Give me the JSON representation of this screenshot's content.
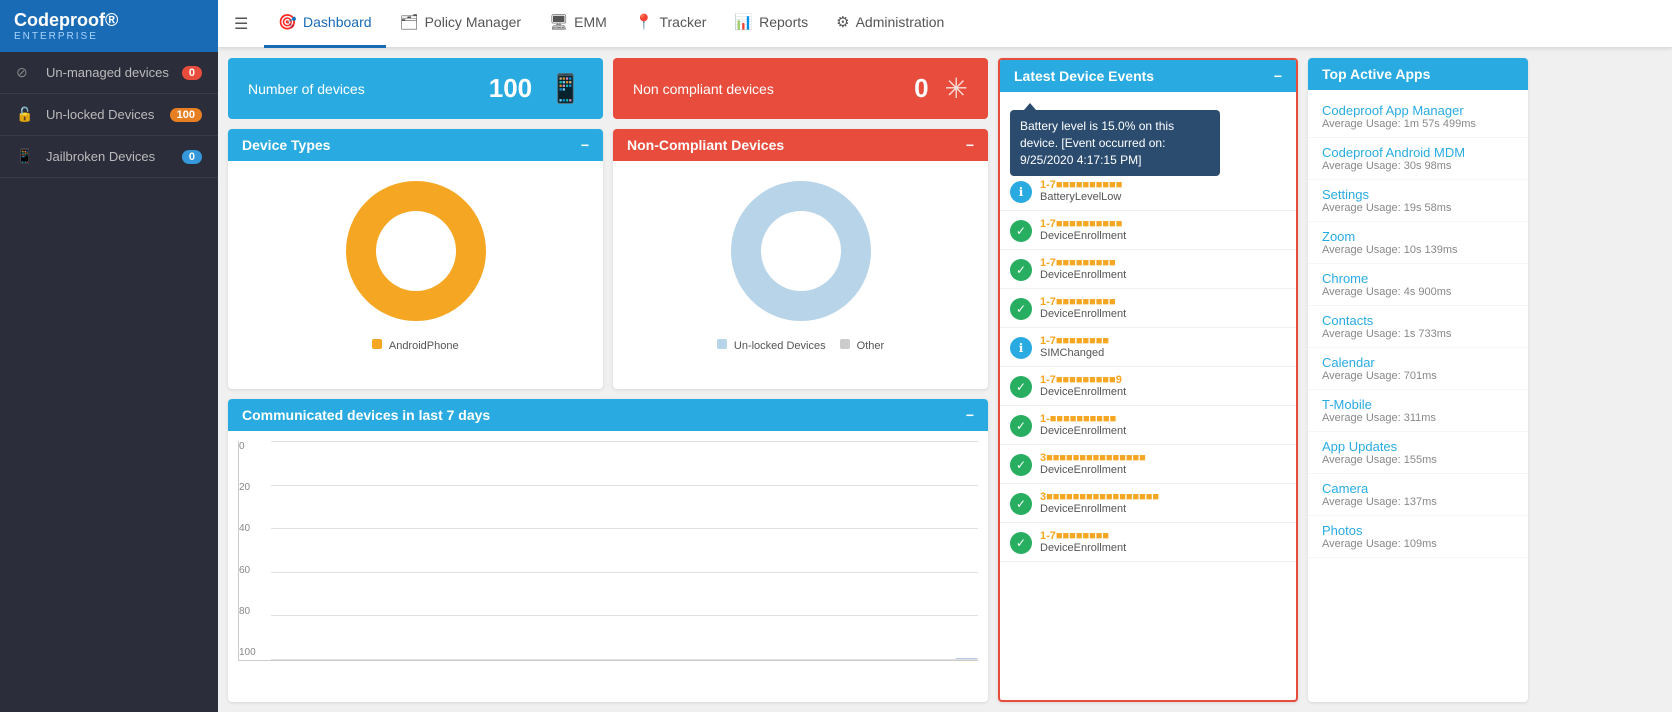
{
  "sidebar": {
    "logo": "Codeproof®",
    "logo_sub": "ENTERPRISE",
    "items": [
      {
        "id": "unmanaged",
        "label": "Un-managed devices",
        "badge": "0",
        "badge_type": "red"
      },
      {
        "id": "unlocked",
        "label": "Un-locked Devices",
        "badge": "100",
        "badge_type": "orange"
      },
      {
        "id": "jailbroken",
        "label": "Jailbroken Devices",
        "badge": "0",
        "badge_type": "blue"
      }
    ]
  },
  "topnav": {
    "items": [
      {
        "id": "dashboard",
        "label": "Dashboard",
        "active": true
      },
      {
        "id": "policy",
        "label": "Policy Manager",
        "active": false
      },
      {
        "id": "emm",
        "label": "EMM",
        "active": false
      },
      {
        "id": "tracker",
        "label": "Tracker",
        "active": false
      },
      {
        "id": "reports",
        "label": "Reports",
        "active": false
      },
      {
        "id": "admin",
        "label": "Administration",
        "active": false
      }
    ]
  },
  "stats": {
    "devices": {
      "label": "Number of devices",
      "value": "100"
    },
    "noncompliant": {
      "label": "Non compliant devices",
      "value": "0"
    }
  },
  "device_types": {
    "title": "Device Types",
    "legend": [
      {
        "label": "AndroidPhone",
        "color": "#f5a623"
      }
    ]
  },
  "noncompliant_devices": {
    "title": "Non-Compliant Devices",
    "legend": [
      {
        "label": "Un-locked Devices",
        "color": "#b8d4e8"
      },
      {
        "label": "Other",
        "color": "#ccc"
      }
    ]
  },
  "communicated": {
    "title": "Communicated devices in last 7 days",
    "y_labels": [
      "0",
      "20",
      "40",
      "60",
      "80",
      "100"
    ],
    "bars": [
      0,
      0,
      0,
      0,
      0,
      0,
      0,
      0,
      0,
      0,
      0,
      0,
      0,
      0,
      0,
      0,
      0,
      0,
      0,
      0,
      0,
      0,
      0,
      0,
      0,
      0,
      0,
      95
    ]
  },
  "latest_events": {
    "title": "Latest Device Events",
    "tooltip": "Battery level is 15.0% on this device. [Event occurred on: 9/25/2020 4:17:15 PM]",
    "items": [
      {
        "id": 1,
        "device": "1-7■■■■■■■■■■",
        "type": "BatteryLevelLow",
        "icon": "info",
        "color": "blue"
      },
      {
        "id": 2,
        "device": "1-7■■■■■■■■■■",
        "type": "DeviceEnrollment",
        "icon": "check",
        "color": "green"
      },
      {
        "id": 3,
        "device": "1-7■■■■■■■■■",
        "type": "DeviceEnrollment",
        "icon": "check",
        "color": "green"
      },
      {
        "id": 4,
        "device": "1-7■■■■■■■■■",
        "type": "DeviceEnrollment",
        "icon": "check",
        "color": "green"
      },
      {
        "id": 5,
        "device": "1-7■■■■■■■■",
        "type": "SIMChanged",
        "icon": "info",
        "color": "blue"
      },
      {
        "id": 6,
        "device": "1-7■■■■■■■■■9",
        "type": "DeviceEnrollment",
        "icon": "check",
        "color": "green"
      },
      {
        "id": 7,
        "device": "1-■■■■■■■■■■",
        "type": "DeviceEnrollment",
        "icon": "check",
        "color": "green"
      },
      {
        "id": 8,
        "device": "3■■■■■■■■■■■■■■■",
        "type": "DeviceEnrollment",
        "icon": "check",
        "color": "green"
      },
      {
        "id": 9,
        "device": "3■■■■■■■■■■■■■■■■■",
        "type": "DeviceEnrollment",
        "icon": "check",
        "color": "green"
      },
      {
        "id": 10,
        "device": "1-7■■■■■■■■",
        "type": "DeviceEnrollment",
        "icon": "check",
        "color": "green"
      }
    ]
  },
  "top_apps": {
    "title": "Top Active Apps",
    "items": [
      {
        "name": "Codeproof App Manager",
        "usage": "Average Usage: 1m 57s 499ms"
      },
      {
        "name": "Codeproof Android MDM",
        "usage": "Average Usage: 30s 98ms"
      },
      {
        "name": "Settings",
        "usage": "Average Usage: 19s 58ms"
      },
      {
        "name": "Zoom",
        "usage": "Average Usage: 10s 139ms"
      },
      {
        "name": "Chrome",
        "usage": "Average Usage: 4s 900ms"
      },
      {
        "name": "Contacts",
        "usage": "Average Usage: 1s 733ms"
      },
      {
        "name": "Calendar",
        "usage": "Average Usage: 701ms"
      },
      {
        "name": "T-Mobile",
        "usage": "Average Usage: 311ms"
      },
      {
        "name": "App Updates",
        "usage": "Average Usage: 155ms"
      },
      {
        "name": "Camera",
        "usage": "Average Usage: 137ms"
      },
      {
        "name": "Photos",
        "usage": "Average Usage: 109ms"
      }
    ]
  }
}
